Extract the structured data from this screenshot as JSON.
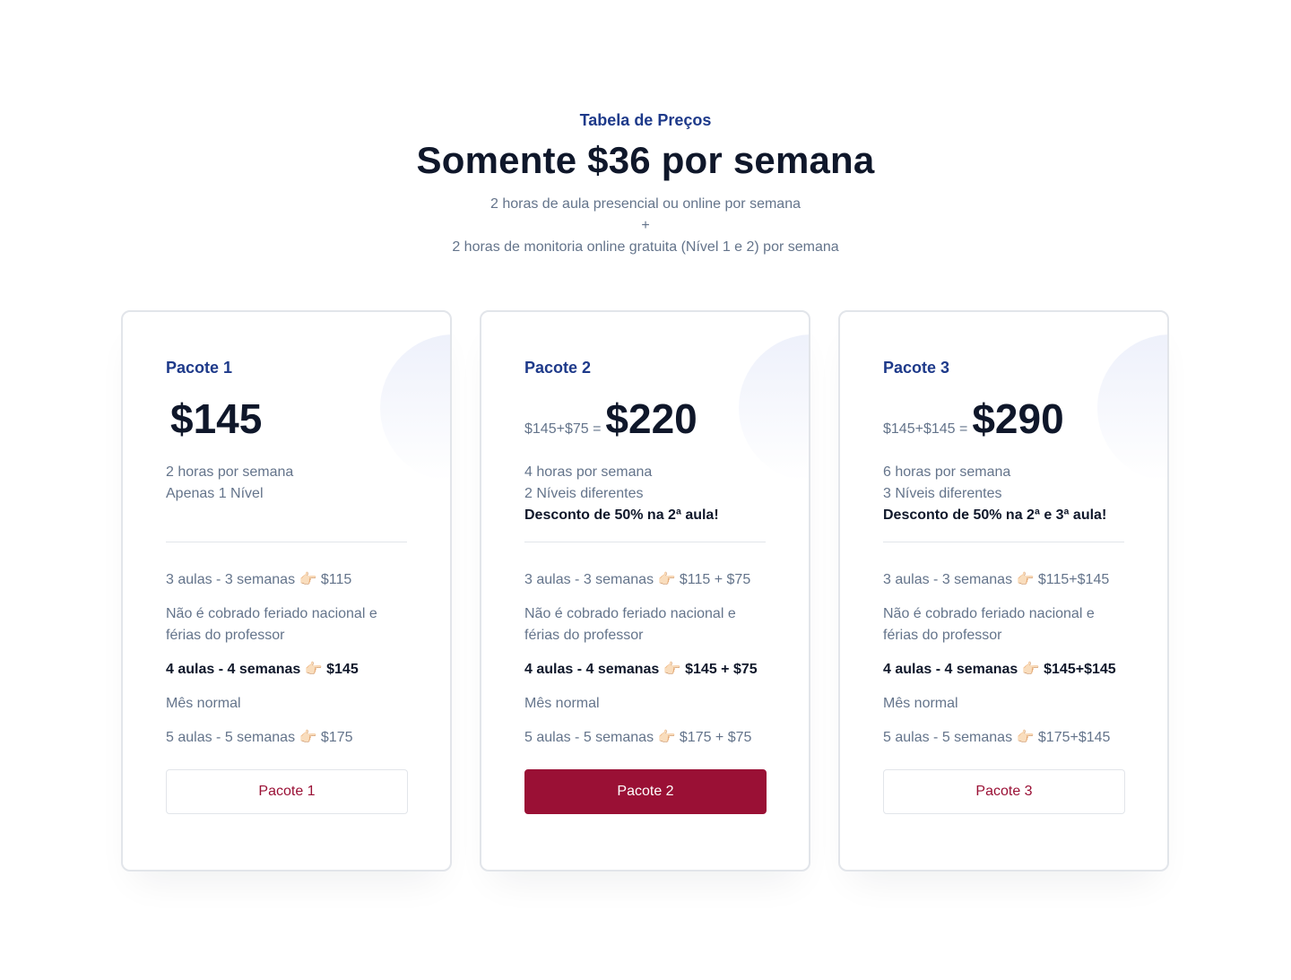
{
  "header": {
    "eyebrow": "Tabela de Preços",
    "title": "Somente $36 por semana",
    "subtitle_line1": "2 horas de aula presencial ou online  por semana",
    "subtitle_line2": "+",
    "subtitle_line3": "2 horas de monitoria online gratuita (Nível 1 e 2)  por semana"
  },
  "colors": {
    "accent": "#9a1035",
    "plan_name": "#1e3a8a",
    "heading": "#0f172a",
    "muted": "#64748b"
  },
  "cards": [
    {
      "name": "Pacote 1",
      "price_prefix": "",
      "price": "$145",
      "desc_line1": "2 horas por semana",
      "desc_line2": "Apenas 1 Nível",
      "desc_bold": "",
      "features": [
        "3 aulas - 3 semanas 👉🏻 $115",
        "Não é cobrado feriado nacional e férias do professor",
        "4 aulas - 4 semanas 👉🏻 $145",
        "Mês normal",
        "5 aulas - 5 semanas 👉🏻 $175"
      ],
      "button": "Pacote 1"
    },
    {
      "name": "Pacote 2",
      "price_prefix": "$145+$75 =",
      "price": "$220",
      "desc_line1": "4 horas por semana",
      "desc_line2": "2 Níveis diferentes",
      "desc_bold": "Desconto de 50% na 2ª aula!",
      "features": [
        "3 aulas - 3 semanas 👉🏻 $115 + $75",
        "Não é cobrado feriado nacional e férias do professor",
        "4 aulas - 4 semanas 👉🏻 $145 + $75",
        "Mês normal",
        "5 aulas - 5 semanas 👉🏻 $175 + $75"
      ],
      "button": "Pacote 2"
    },
    {
      "name": "Pacote 3",
      "price_prefix": "$145+$145 =",
      "price": "$290",
      "desc_line1": "6 horas por semana",
      "desc_line2": "3 Níveis diferentes",
      "desc_bold": "Desconto de 50% na 2ª e 3ª aula!",
      "features": [
        "3 aulas - 3 semanas 👉🏻 $115+$145",
        "Não é cobrado feriado nacional e férias do professor",
        "4 aulas - 4 semanas 👉🏻 $145+$145",
        "Mês normal",
        "5 aulas - 5 semanas 👉🏻 $175+$145"
      ],
      "button": "Pacote 3"
    }
  ]
}
